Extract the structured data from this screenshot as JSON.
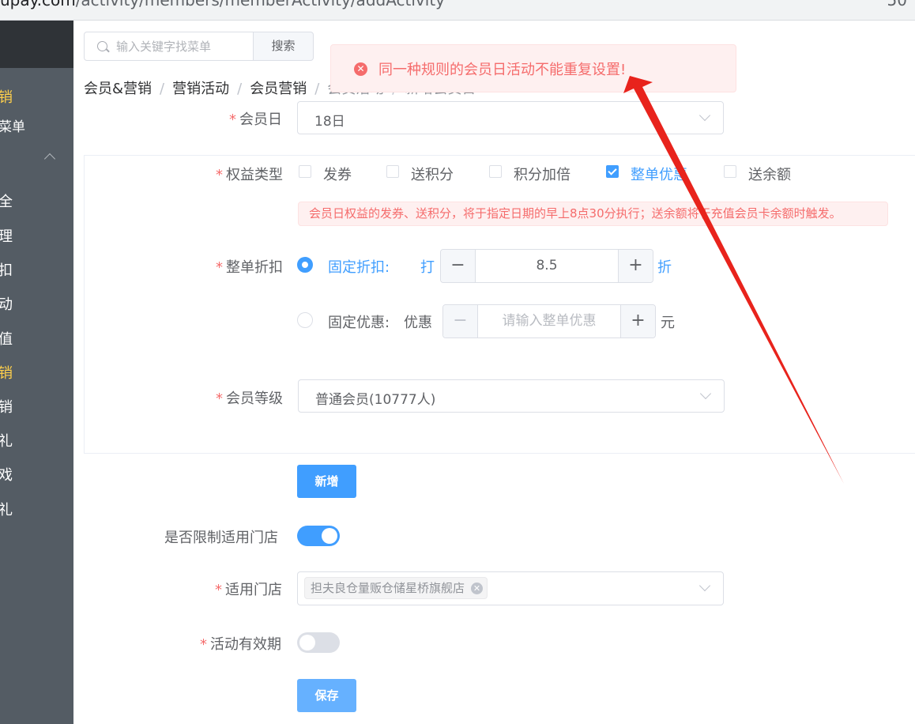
{
  "browser": {
    "url_host": "upay.com",
    "url_path": "/activity/members/memberActivity/addActivity",
    "right_glyph": "50"
  },
  "sidebar": {
    "items": [
      {
        "label": "销",
        "active": true
      },
      {
        "label": "菜单"
      },
      {
        "label": "全"
      },
      {
        "label": "理"
      },
      {
        "label": "扣"
      },
      {
        "label": "动"
      },
      {
        "label": "值"
      },
      {
        "label": "销",
        "active": true
      },
      {
        "label": "销"
      },
      {
        "label": "礼"
      },
      {
        "label": "戏"
      },
      {
        "label": "礼"
      }
    ]
  },
  "header": {
    "search_placeholder": "输入关键字找菜单",
    "search_button": "搜索"
  },
  "breadcrumb": [
    "会员&营销",
    "营销活动",
    "会员营销",
    "会员活动",
    "新增会员日"
  ],
  "toast": {
    "message": "同一种规则的会员日活动不能重复设置!"
  },
  "form": {
    "member_day": {
      "label": "会员日",
      "value": "18日"
    },
    "benefit_type": {
      "label": "权益类型",
      "options": [
        {
          "label": "发券",
          "checked": false
        },
        {
          "label": "送积分",
          "checked": false
        },
        {
          "label": "积分加倍",
          "checked": false
        },
        {
          "label": "整单优惠",
          "checked": true
        },
        {
          "label": "送余额",
          "checked": false
        }
      ],
      "hint": "会员日权益的发券、送积分，将于指定日期的早上8点30分执行；送余额将于充值会员卡余额时触发。"
    },
    "order_discount": {
      "label": "整单折扣",
      "fixed_discount": {
        "label": "固定折扣:",
        "prefix": "打",
        "value": "8.5",
        "suffix": "折",
        "selected": true
      },
      "fixed_offer": {
        "label": "固定优惠:",
        "prefix": "优惠",
        "placeholder": "请输入整单优惠",
        "suffix": "元",
        "selected": false
      }
    },
    "member_level": {
      "label": "会员等级",
      "value": "普通会员(10777人)"
    },
    "add_button": "新增",
    "limit_store": {
      "label": "是否限制适用门店",
      "on": true
    },
    "stores": {
      "label": "适用门店",
      "tags": [
        "担夫良仓量贩仓储星桥旗舰店"
      ]
    },
    "validity": {
      "label": "活动有效期",
      "on": false
    },
    "save_button": "保存"
  },
  "colors": {
    "primary": "#409eff",
    "danger": "#f56c6c",
    "sidebar": "#545c64",
    "active_menu": "#ffd04b",
    "arrow": "#e8231c"
  }
}
